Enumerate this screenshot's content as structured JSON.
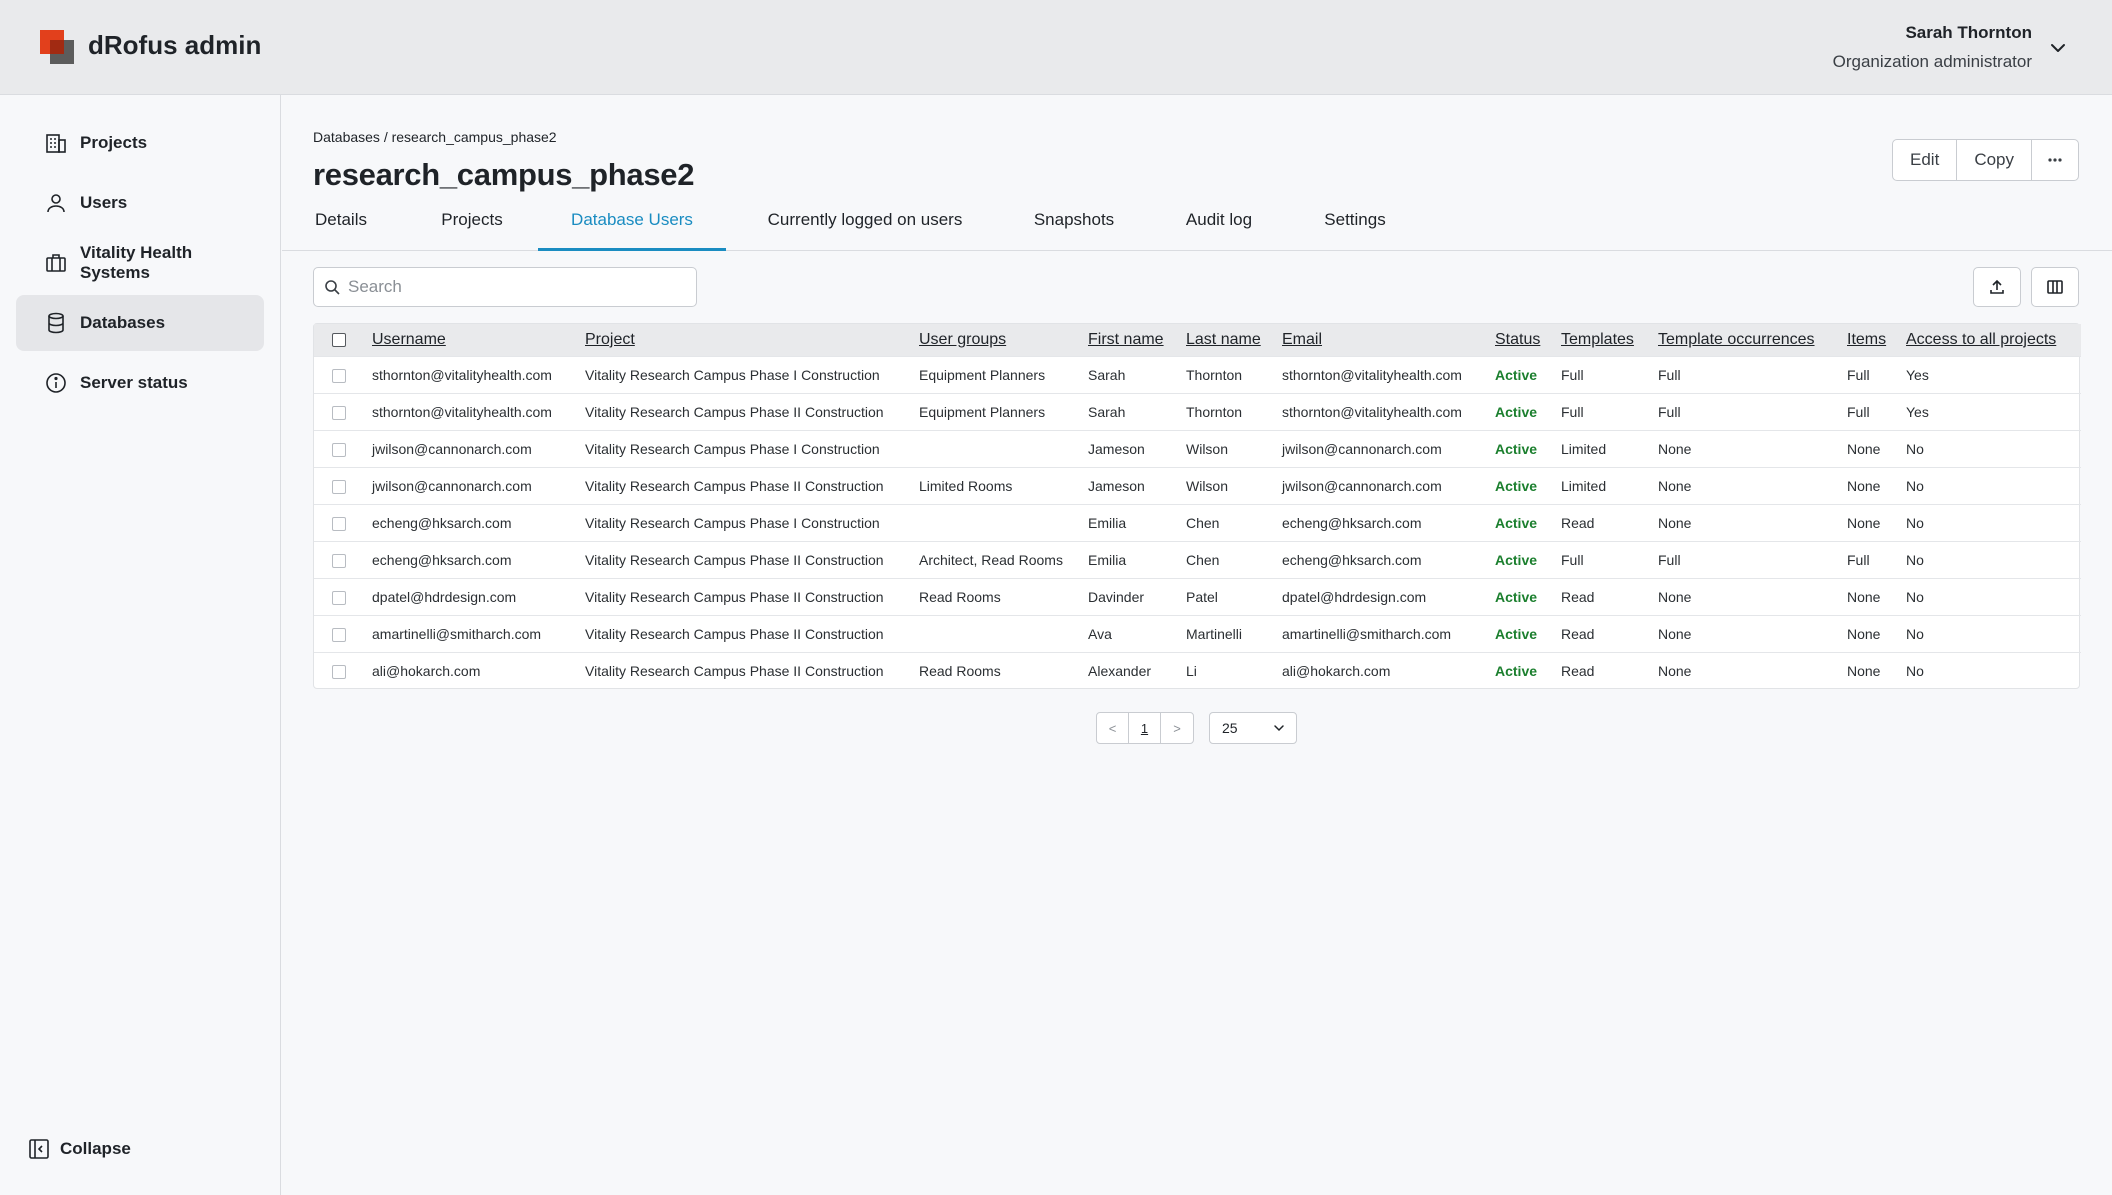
{
  "app": {
    "title": "dRofus admin"
  },
  "user": {
    "name": "Sarah Thornton",
    "role": "Organization administrator"
  },
  "sidebar": {
    "items": [
      {
        "label": "Projects",
        "icon": "building-icon"
      },
      {
        "label": "Users",
        "icon": "user-icon"
      },
      {
        "label": "Vitality Health Systems",
        "icon": "briefcase-icon"
      },
      {
        "label": "Databases",
        "icon": "database-icon",
        "active": true
      },
      {
        "label": "Server status",
        "icon": "info-icon"
      }
    ],
    "collapse_label": "Collapse"
  },
  "page": {
    "breadcrumb": "Databases / research_campus_phase2",
    "title": "research_campus_phase2",
    "actions": {
      "edit": "Edit",
      "copy": "Copy",
      "more": "···"
    }
  },
  "tabs": [
    {
      "label": "Details"
    },
    {
      "label": "Projects"
    },
    {
      "label": "Database Users",
      "active": true
    },
    {
      "label": "Currently logged on users"
    },
    {
      "label": "Snapshots"
    },
    {
      "label": "Audit log"
    },
    {
      "label": "Settings"
    }
  ],
  "search": {
    "placeholder": "Search",
    "value": ""
  },
  "table": {
    "columns": [
      "Username",
      "Project",
      "User groups",
      "First name",
      "Last name",
      "Email",
      "Status",
      "Templates",
      "Template occurrences",
      "Items",
      "Access to all projects"
    ],
    "rows": [
      [
        "sthornton@vitalityhealth.com",
        "Vitality Research Campus Phase I Construction",
        "Equipment Planners",
        "Sarah",
        "Thornton",
        "sthornton@vitalityhealth.com",
        "Active",
        "Full",
        "Full",
        "Full",
        "Yes"
      ],
      [
        "sthornton@vitalityhealth.com",
        "Vitality Research Campus Phase II Construction",
        "Equipment Planners",
        "Sarah",
        "Thornton",
        "sthornton@vitalityhealth.com",
        "Active",
        "Full",
        "Full",
        "Full",
        "Yes"
      ],
      [
        "jwilson@cannonarch.com",
        "Vitality Research Campus Phase I Construction",
        "",
        "Jameson",
        "Wilson",
        "jwilson@cannonarch.com",
        "Active",
        "Limited",
        "None",
        "None",
        "No"
      ],
      [
        "jwilson@cannonarch.com",
        "Vitality Research Campus Phase II Construction",
        "Limited Rooms",
        "Jameson",
        "Wilson",
        "jwilson@cannonarch.com",
        "Active",
        "Limited",
        "None",
        "None",
        "No"
      ],
      [
        "echeng@hksarch.com",
        "Vitality Research Campus Phase I Construction",
        "",
        "Emilia",
        "Chen",
        "echeng@hksarch.com",
        "Active",
        "Read",
        "None",
        "None",
        "No"
      ],
      [
        "echeng@hksarch.com",
        "Vitality Research Campus Phase II Construction",
        "Architect, Read Rooms",
        "Emilia",
        "Chen",
        "echeng@hksarch.com",
        "Active",
        "Full",
        "Full",
        "Full",
        "No"
      ],
      [
        "dpatel@hdrdesign.com",
        "Vitality Research Campus Phase II Construction",
        "Read Rooms",
        "Davinder",
        "Patel",
        "dpatel@hdrdesign.com",
        "Active",
        "Read",
        "None",
        "None",
        "No"
      ],
      [
        "amartinelli@smitharch.com",
        "Vitality Research Campus Phase II Construction",
        "",
        "Ava",
        "Martinelli",
        "amartinelli@smitharch.com",
        "Active",
        "Read",
        "None",
        "None",
        "No"
      ],
      [
        "ali@hokarch.com",
        "Vitality Research Campus Phase II Construction",
        "Read Rooms",
        "Alexander",
        "Li",
        "ali@hokarch.com",
        "Active",
        "Read",
        "None",
        "None",
        "No"
      ]
    ]
  },
  "pagination": {
    "prev": "<",
    "current": "1",
    "next": ">",
    "page_size": "25"
  },
  "colors": {
    "accent": "#1a8cc1",
    "status_active": "#1b7f2e",
    "brand": "#e2401c"
  }
}
